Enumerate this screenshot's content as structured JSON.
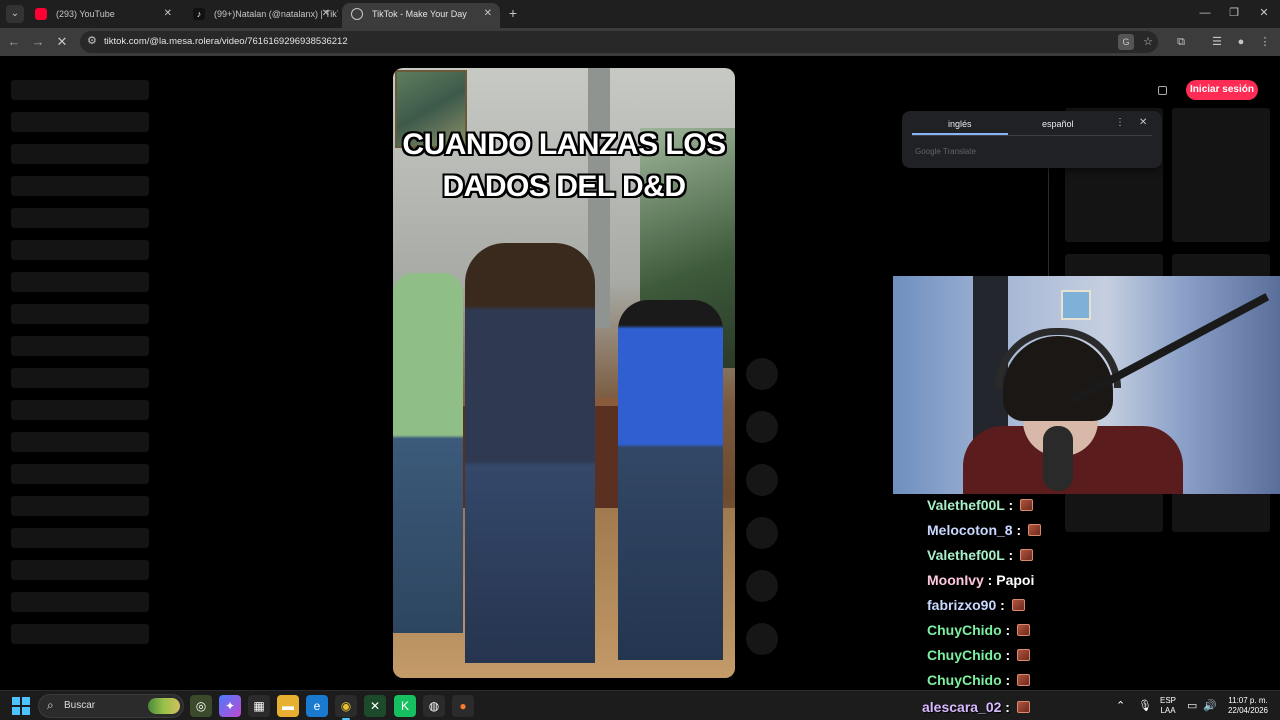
{
  "browser": {
    "tabs": [
      {
        "title": "(293) YouTube",
        "favicon": "youtube-icon",
        "color": "#ff0033",
        "active": false
      },
      {
        "title": "(99+)Natalan (@natalanx) | TikT",
        "favicon": "tiktok-icon",
        "color": "#000000",
        "active": false
      },
      {
        "title": "TikTok - Make Your Day",
        "favicon": "globe-icon",
        "color": "#3c3c3c",
        "active": true
      }
    ],
    "url": "tiktok.com/@la.mesa.rolera/video/7616169296938536212"
  },
  "translate_popup": {
    "languages": [
      "inglés",
      "español"
    ],
    "selected": "inglés",
    "brand": "Google Translate"
  },
  "page": {
    "login_label": "Iniciar sesión",
    "accent_color": "#fe2c55",
    "video_caption": "CUANDO LANZAS LOS DADOS DEL D&D"
  },
  "chat": {
    "messages": [
      {
        "user": "Valethef00L",
        "color": "#a8f0c8",
        "msg": "",
        "emote": true
      },
      {
        "user": "Melocoton_8",
        "color": "#c8d8ff",
        "msg": "",
        "emote": true
      },
      {
        "user": "Valethef00L",
        "color": "#a8f0c8",
        "msg": "",
        "emote": true
      },
      {
        "user": "MoonIvy",
        "color": "#ffc8e0",
        "msg": "Papoi",
        "emote": false
      },
      {
        "user": "fabrizxo90",
        "color": "#c8d8ff",
        "msg": "",
        "emote": true
      },
      {
        "user": "ChuyChido",
        "color": "#7cf0a0",
        "msg": "",
        "emote": true
      },
      {
        "user": "ChuyChido",
        "color": "#7cf0a0",
        "msg": "",
        "emote": true
      },
      {
        "user": "ChuyChido",
        "color": "#7cf0a0",
        "msg": "",
        "emote": true
      },
      {
        "user": "alescara_02",
        "color": "#d8b8ff",
        "msg": "",
        "emote": true
      }
    ]
  },
  "taskbar": {
    "search_label": "Buscar",
    "language": "ESP",
    "layout": "LAA",
    "time": "11:07 p. m.",
    "date": "22/04/2026"
  }
}
